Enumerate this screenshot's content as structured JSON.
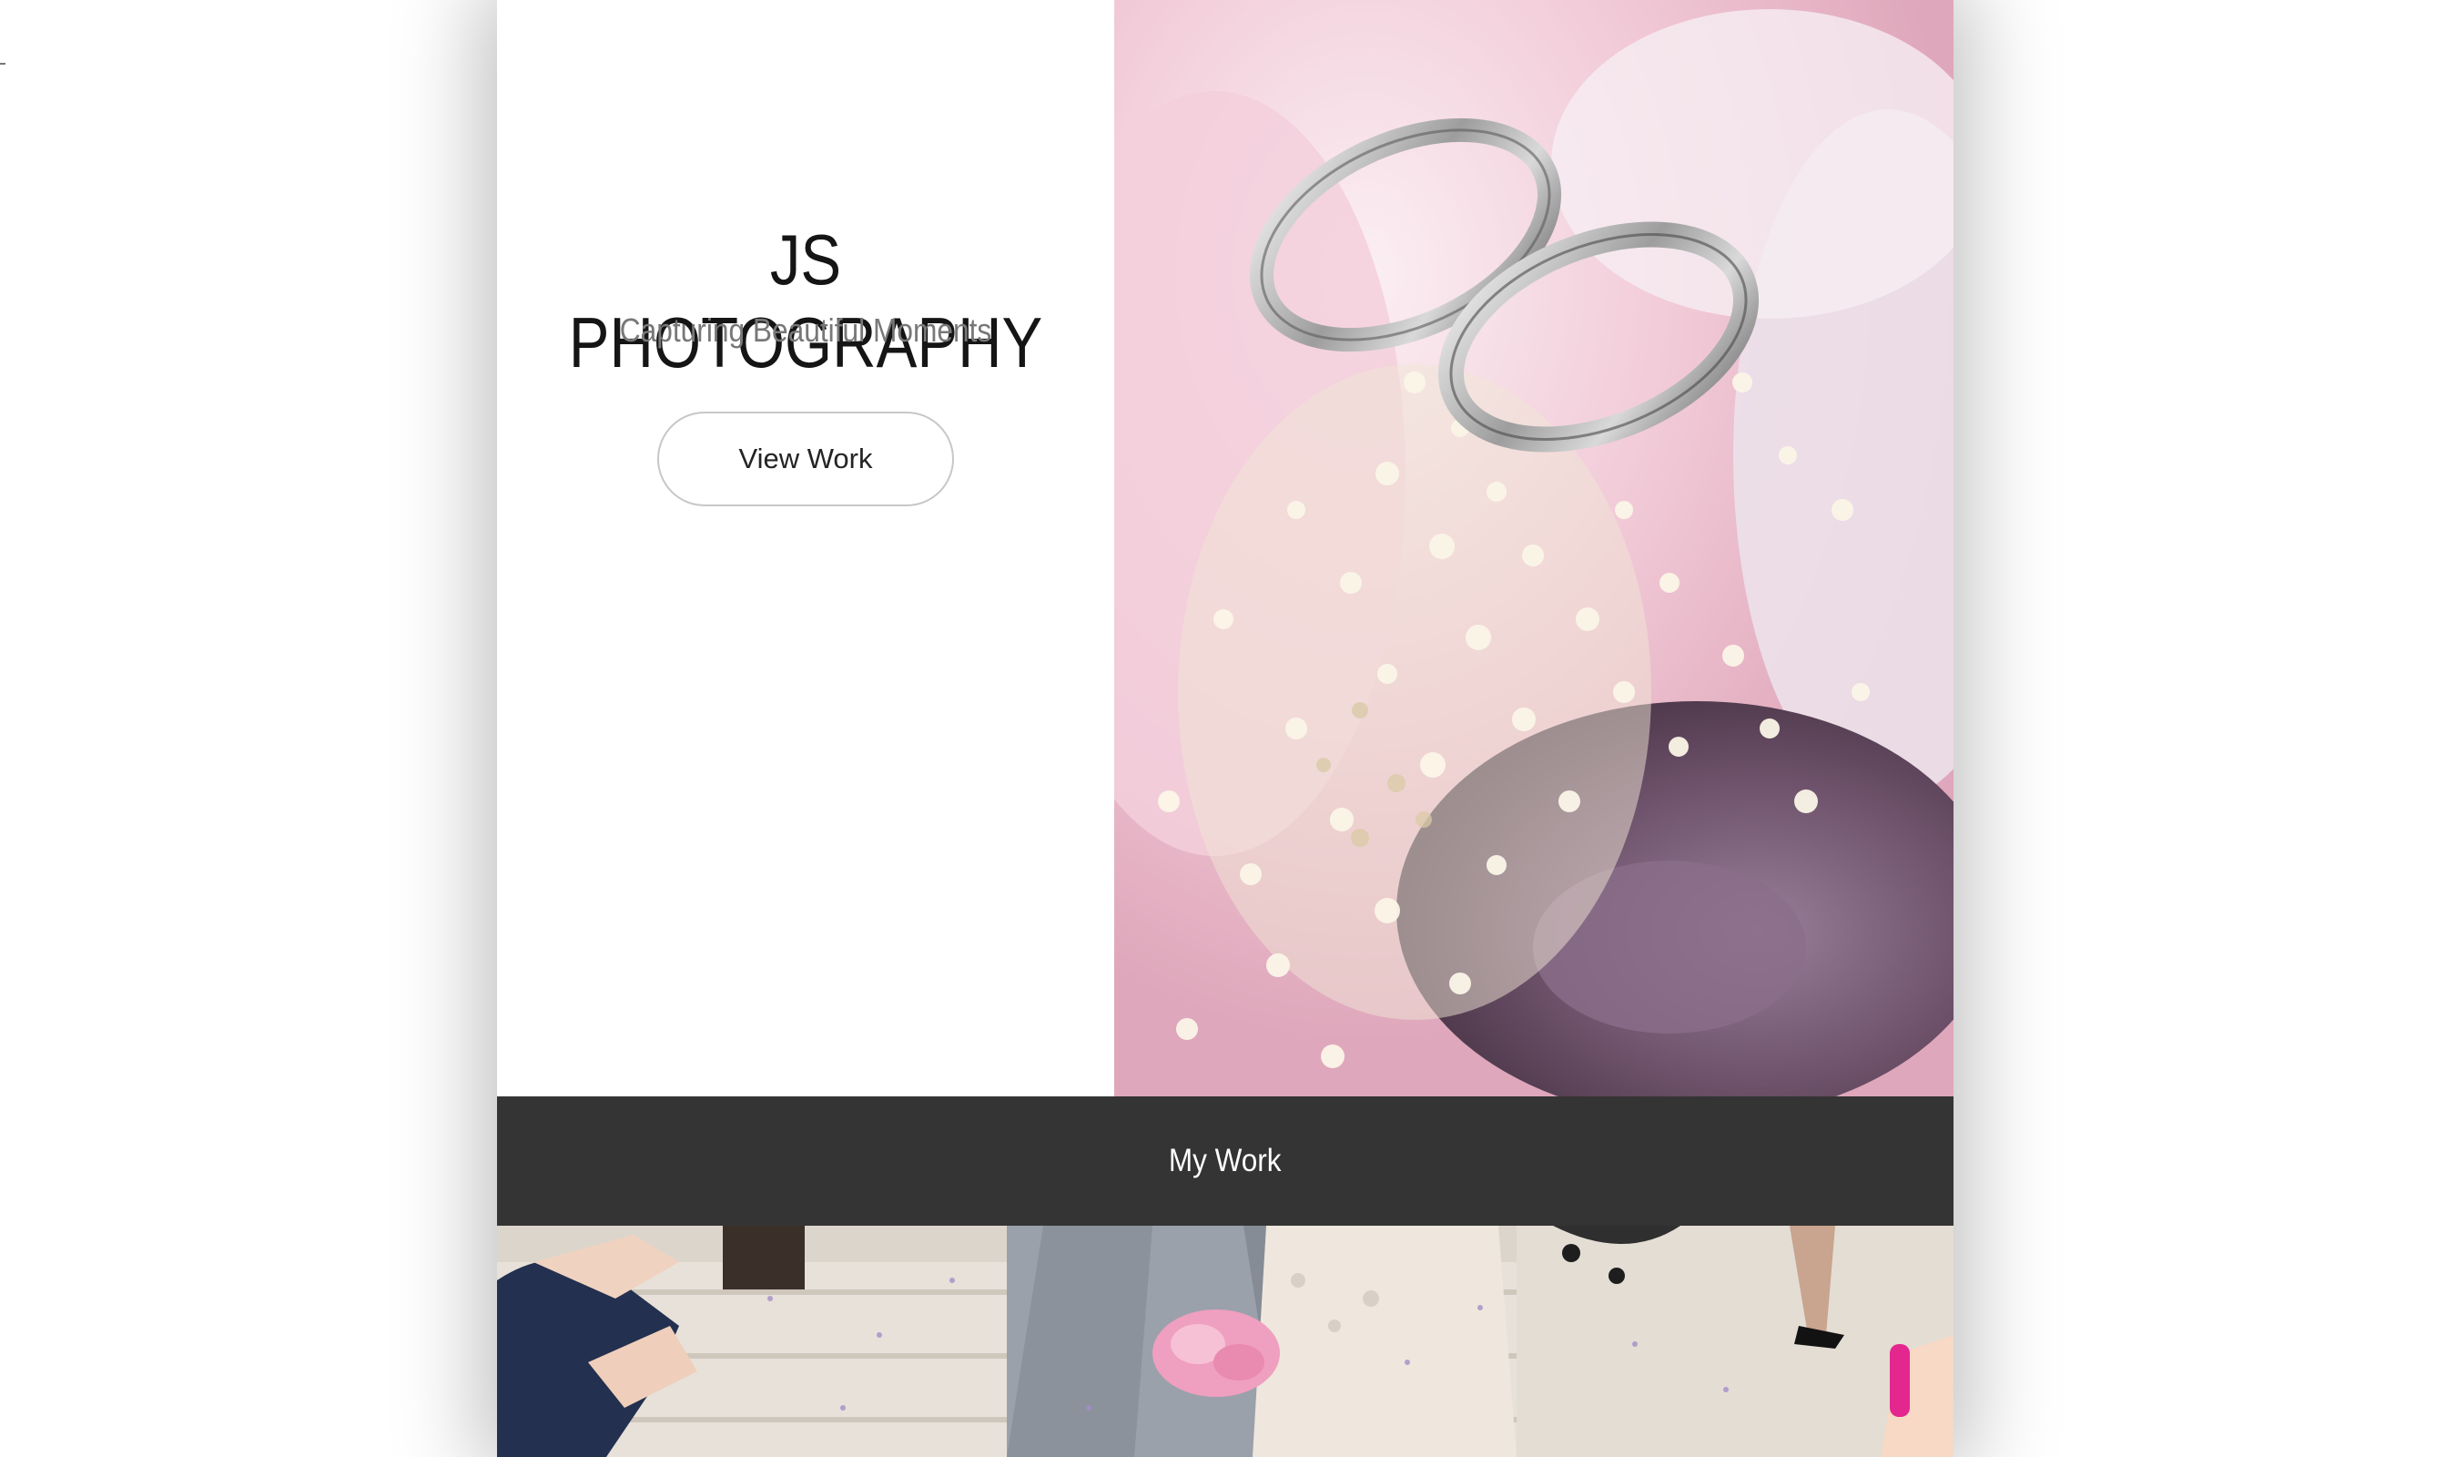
{
  "hero": {
    "title": "JS PHOTOGRAPHY",
    "tagline": "Capturing Beautiful Moments",
    "cta_label": "View Work",
    "image": "wedding-rings-on-bouquet"
  },
  "section": {
    "title": "My Work"
  },
  "gallery": {
    "image": "couple-walking-through-confetti"
  },
  "colors": {
    "section_bar": "#343434",
    "title_text": "#151515",
    "tagline_text": "#787878"
  }
}
